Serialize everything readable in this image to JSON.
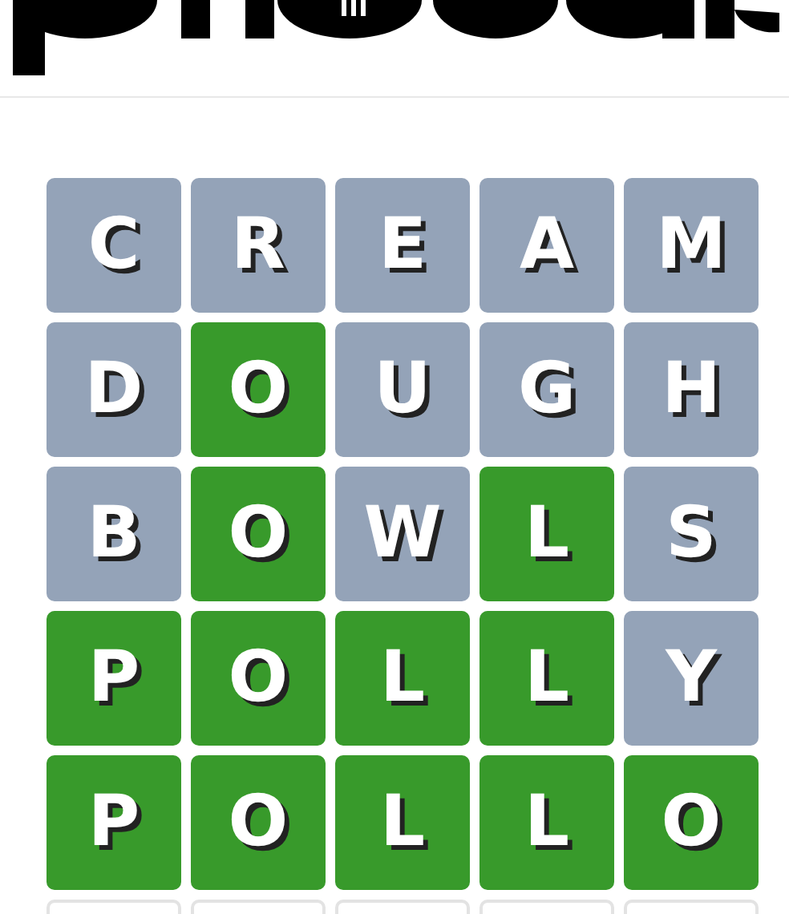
{
  "board": [
    [
      {
        "letter": "C",
        "kind": "absent"
      },
      {
        "letter": "R",
        "kind": "absent"
      },
      {
        "letter": "E",
        "kind": "absent"
      },
      {
        "letter": "A",
        "kind": "absent"
      },
      {
        "letter": "M",
        "kind": "absent"
      }
    ],
    [
      {
        "letter": "D",
        "kind": "absent"
      },
      {
        "letter": "O",
        "kind": "correct"
      },
      {
        "letter": "U",
        "kind": "absent"
      },
      {
        "letter": "G",
        "kind": "absent"
      },
      {
        "letter": "H",
        "kind": "absent"
      }
    ],
    [
      {
        "letter": "B",
        "kind": "absent"
      },
      {
        "letter": "O",
        "kind": "correct"
      },
      {
        "letter": "W",
        "kind": "absent"
      },
      {
        "letter": "L",
        "kind": "correct"
      },
      {
        "letter": "S",
        "kind": "absent"
      }
    ],
    [
      {
        "letter": "P",
        "kind": "correct"
      },
      {
        "letter": "O",
        "kind": "correct"
      },
      {
        "letter": "L",
        "kind": "correct"
      },
      {
        "letter": "L",
        "kind": "correct"
      },
      {
        "letter": "Y",
        "kind": "absent"
      }
    ],
    [
      {
        "letter": "P",
        "kind": "correct"
      },
      {
        "letter": "O",
        "kind": "correct"
      },
      {
        "letter": "L",
        "kind": "correct"
      },
      {
        "letter": "L",
        "kind": "correct"
      },
      {
        "letter": "O",
        "kind": "correct"
      }
    ],
    [
      {
        "kind": "empty"
      },
      {
        "kind": "empty"
      },
      {
        "kind": "empty"
      },
      {
        "kind": "empty"
      },
      {
        "kind": "empty"
      }
    ]
  ]
}
